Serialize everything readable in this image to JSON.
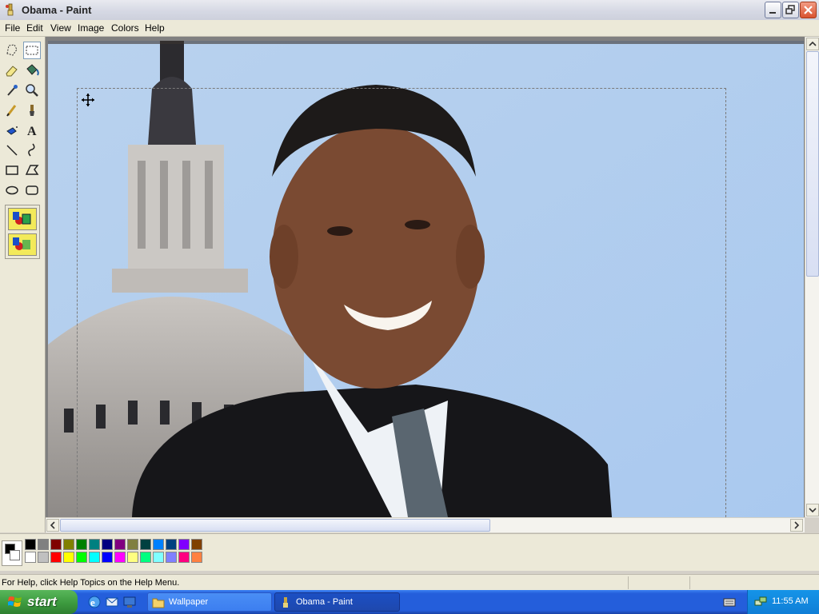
{
  "window": {
    "title": "Obama - Paint",
    "app_icon": "paint-icon",
    "controls": [
      "minimize-icon",
      "restore-icon",
      "close-icon"
    ]
  },
  "menu": {
    "items": [
      "File",
      "Edit",
      "View",
      "Image",
      "Colors",
      "Help"
    ]
  },
  "toolbox": {
    "tools": [
      "free-form-select",
      "select",
      "eraser",
      "fill-with-color",
      "pick-color",
      "magnifier",
      "pencil",
      "brush",
      "airbrush",
      "text",
      "line",
      "curve",
      "rectangle",
      "polygon",
      "ellipse",
      "rounded-rectangle"
    ],
    "selected_tool": "select",
    "options": [
      "opaque-selection",
      "transparent-selection"
    ]
  },
  "canvas": {
    "image_subject": "portrait photo in front of capitol dome",
    "selection_active": true,
    "cursor": "move-cursor-icon"
  },
  "palette": {
    "foreground": "#000000",
    "background": "#ffffff",
    "top_row": [
      "#000000",
      "#808080",
      "#800000",
      "#808000",
      "#008000",
      "#008080",
      "#000080",
      "#800080",
      "#808040",
      "#004040",
      "#0080ff",
      "#004080",
      "#8000ff",
      "#804000"
    ],
    "bottom_row": [
      "#ffffff",
      "#c0c0c0",
      "#ff0000",
      "#ffff00",
      "#00ff00",
      "#00ffff",
      "#0000ff",
      "#ff00ff",
      "#ffff80",
      "#00ff80",
      "#80ffff",
      "#8080ff",
      "#ff0080",
      "#ff8040"
    ]
  },
  "status": {
    "help_text": "For Help, click Help Topics on the Help Menu."
  },
  "taskbar": {
    "start_label": "start",
    "quick_launch": [
      "internet-explorer-icon",
      "outlook-express-icon",
      "show-desktop-icon"
    ],
    "tasks": [
      {
        "label": "Wallpaper",
        "icon": "folder-icon",
        "active": false
      },
      {
        "label": "Obama - Paint",
        "icon": "paint-icon",
        "active": true
      }
    ],
    "clock": "11:55 AM"
  }
}
